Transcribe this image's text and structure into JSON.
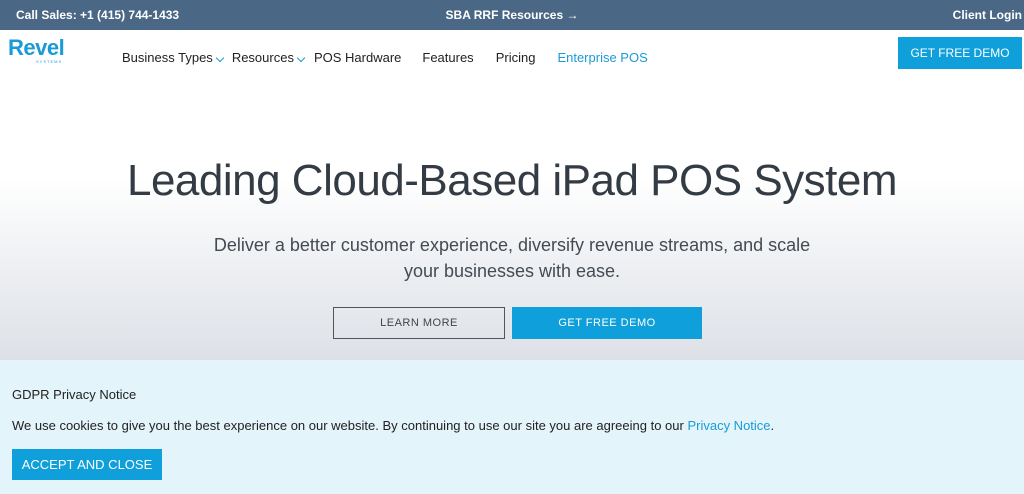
{
  "topbar": {
    "sales": "Call Sales: +1 (415) 744-1433",
    "center_link": "SBA RRF Resources →",
    "client_login": "Client Login"
  },
  "logo": {
    "word": "Revel",
    "sub": "SYSTEMS"
  },
  "nav": {
    "items": [
      {
        "label": "Business Types",
        "dropdown": true
      },
      {
        "label": "Resources",
        "dropdown": true
      },
      {
        "label": "POS Hardware",
        "dropdown": false
      },
      {
        "label": "Features",
        "dropdown": false
      },
      {
        "label": "Pricing",
        "dropdown": false
      },
      {
        "label": "Enterprise POS",
        "dropdown": false
      }
    ],
    "cta": "GET FREE DEMO"
  },
  "hero": {
    "title": "Leading Cloud-Based iPad POS System",
    "subtitle": "Deliver a better customer experience, diversify revenue streams, and scale your businesses with ease.",
    "learn_more": "LEARN MORE",
    "get_demo": "GET FREE DEMO"
  },
  "gdpr": {
    "title": "GDPR Privacy Notice",
    "message": "We use cookies to give you the best experience on our website. By continuing to use our site you are agreeing to our ",
    "link": "Privacy Notice",
    "period": ".",
    "accept": "ACCEPT AND CLOSE"
  },
  "colors": {
    "topbar_bg": "#4a6785",
    "accent": "#0f9fdb",
    "gdpr_bg": "#e3f4fa"
  }
}
